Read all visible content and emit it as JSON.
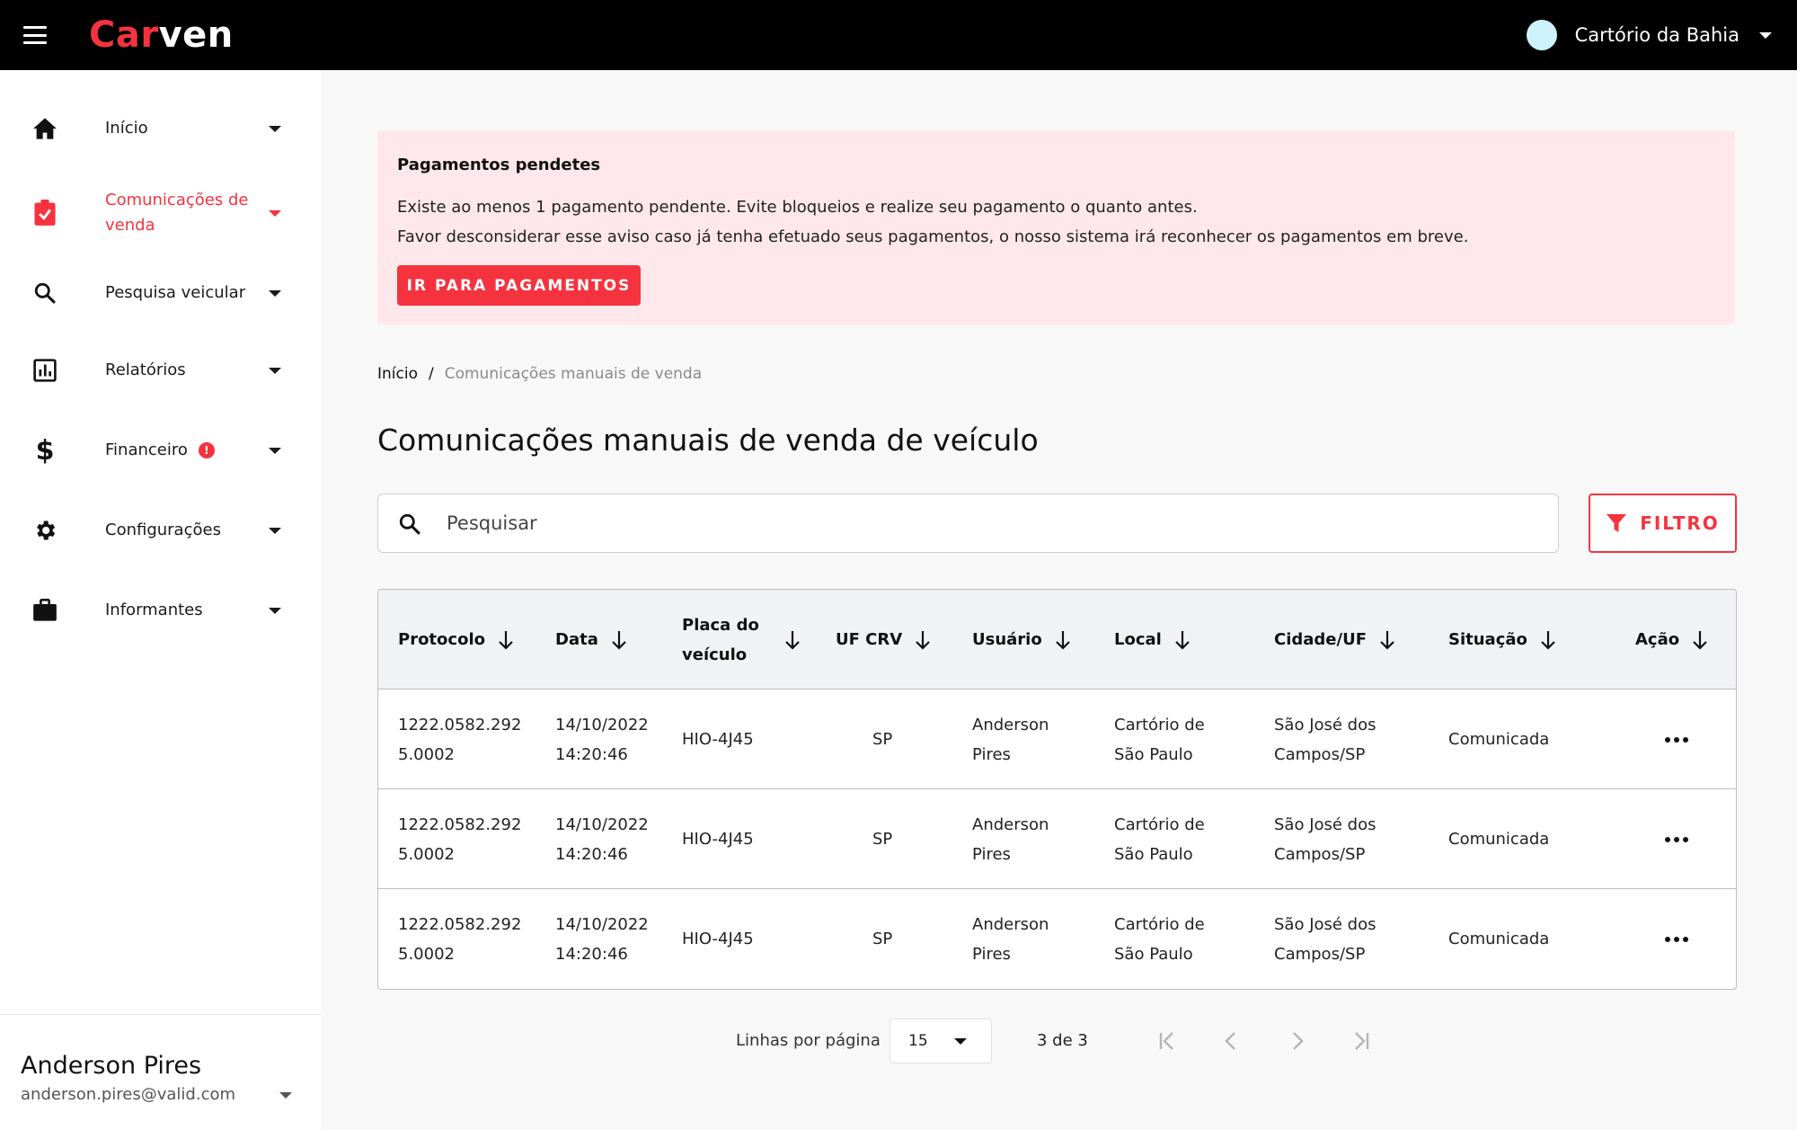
{
  "topbar": {
    "logo_part1": "Car",
    "logo_part2": "ven",
    "account_name": "Cartório da Bahia"
  },
  "sidebar": {
    "items": [
      {
        "label": "Início",
        "icon": "home-icon"
      },
      {
        "label": "Comunicações de venda",
        "icon": "clipboard-check-icon",
        "active": true
      },
      {
        "label": "Pesquisa veicular",
        "icon": "search-icon"
      },
      {
        "label": "Relatórios",
        "icon": "bar-chart-icon"
      },
      {
        "label": "Financeiro",
        "icon": "dollar-icon",
        "badge": "!"
      },
      {
        "label": "Configurações",
        "icon": "gear-icon"
      },
      {
        "label": "Informantes",
        "icon": "briefcase-icon"
      }
    ],
    "user": {
      "name": "Anderson Pires",
      "email": "anderson.pires@valid.com"
    }
  },
  "alert": {
    "title": "Pagamentos pendetes",
    "line1": "Existe ao menos 1 pagamento pendente. Evite bloqueios e realize seu pagamento o quanto antes.",
    "line2": "Favor desconsiderar esse aviso caso já tenha efetuado seus pagamentos, o nosso sistema irá reconhecer os pagamentos em breve.",
    "button": "IR PARA PAGAMENTOS"
  },
  "breadcrumb": {
    "home": "Início",
    "separator": "/",
    "current": "Comunicações manuais de venda"
  },
  "page_title": "Comunicações manuais de venda de veículo",
  "search": {
    "placeholder": "Pesquisar",
    "value": ""
  },
  "filter_button": "FILTRO",
  "table": {
    "headers": [
      "Protocolo",
      "Data",
      "Placa do veículo",
      "UF CRV",
      "Usuário",
      "Local",
      "Cidade/UF",
      "Situação",
      "Ação"
    ],
    "rows": [
      {
        "protocolo": "1222.0582.292 5.0002",
        "data": "14/10/2022 14:20:46",
        "placa": "HIO-4J45",
        "uf": "SP",
        "usuario": "Anderson Pires",
        "local": "Cartório de São Paulo",
        "cidade": "São José dos Campos/SP",
        "situacao": "Comunicada"
      },
      {
        "protocolo": "1222.0582.292 5.0002",
        "data": "14/10/2022 14:20:46",
        "placa": "HIO-4J45",
        "uf": "SP",
        "usuario": "Anderson Pires",
        "local": "Cartório de São Paulo",
        "cidade": "São José dos Campos/SP",
        "situacao": "Comunicada"
      },
      {
        "protocolo": "1222.0582.292 5.0002",
        "data": "14/10/2022 14:20:46",
        "placa": "HIO-4J45",
        "uf": "SP",
        "usuario": "Anderson Pires",
        "local": "Cartório de São Paulo",
        "cidade": "São José dos Campos/SP",
        "situacao": "Comunicada"
      }
    ]
  },
  "pagination": {
    "rows_label": "Linhas por página",
    "rows_value": "15",
    "count": "3 de 3"
  },
  "colors": {
    "accent": "#f5333f",
    "alert_bg": "#ffe8eb",
    "topbar": "#000000"
  }
}
